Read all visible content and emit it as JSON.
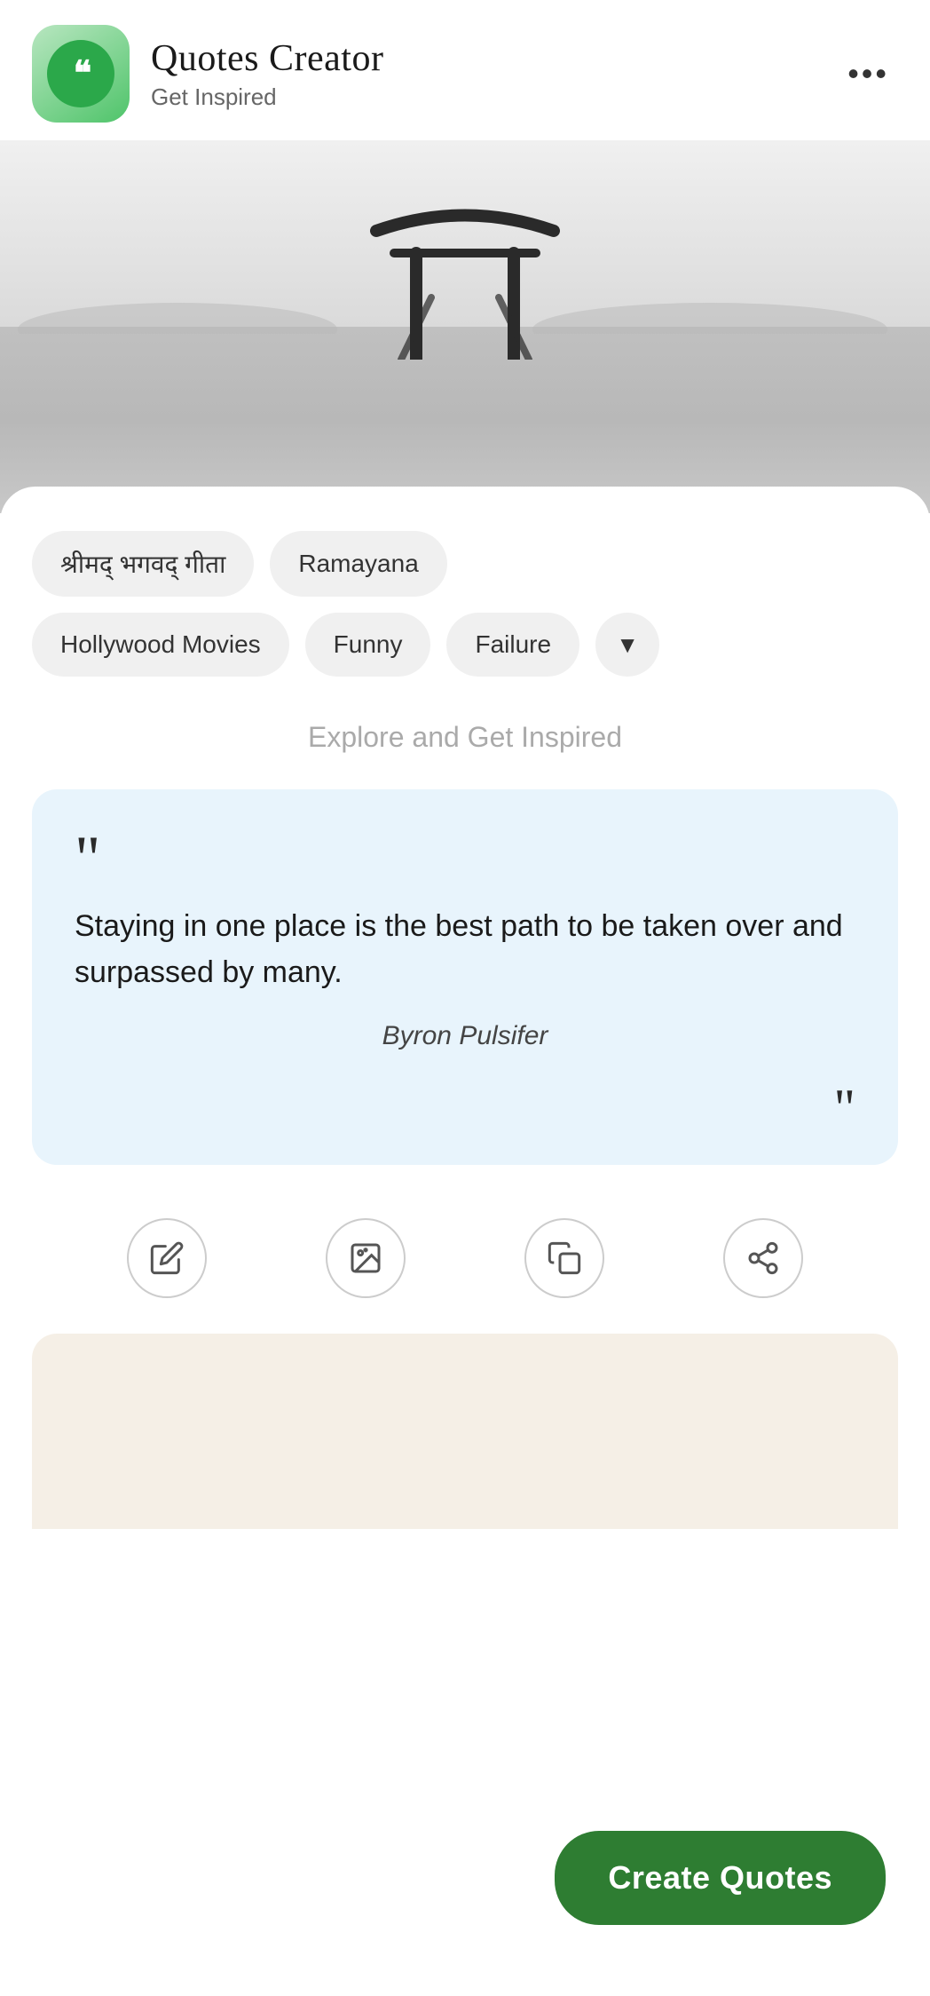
{
  "header": {
    "app_title": "Quotes Creator",
    "app_subtitle": "Get Inspired",
    "more_icon": "•••"
  },
  "categories": {
    "row1": [
      {
        "id": "bhagavad-gita",
        "label": "श्रीमद् भगवद् गीता"
      },
      {
        "id": "ramayana",
        "label": "Ramayana"
      }
    ],
    "row2": [
      {
        "id": "hollywood",
        "label": "Hollywood Movies"
      },
      {
        "id": "funny",
        "label": "Funny"
      },
      {
        "id": "failure",
        "label": "Failure"
      },
      {
        "id": "dropdown",
        "label": "▼"
      }
    ]
  },
  "explore_text": "Explore and Get Inspired",
  "quote": {
    "text": "Staying in one place is the best path to be taken over and surpassed by many.",
    "author": "Byron Pulsifer",
    "open_mark": "““",
    "close_mark": "””"
  },
  "actions": [
    {
      "id": "edit",
      "label": "edit-icon"
    },
    {
      "id": "add-image",
      "label": "add-image-icon"
    },
    {
      "id": "copy",
      "label": "copy-icon"
    },
    {
      "id": "share",
      "label": "share-icon"
    }
  ],
  "create_button": {
    "label": "Create Quotes"
  }
}
